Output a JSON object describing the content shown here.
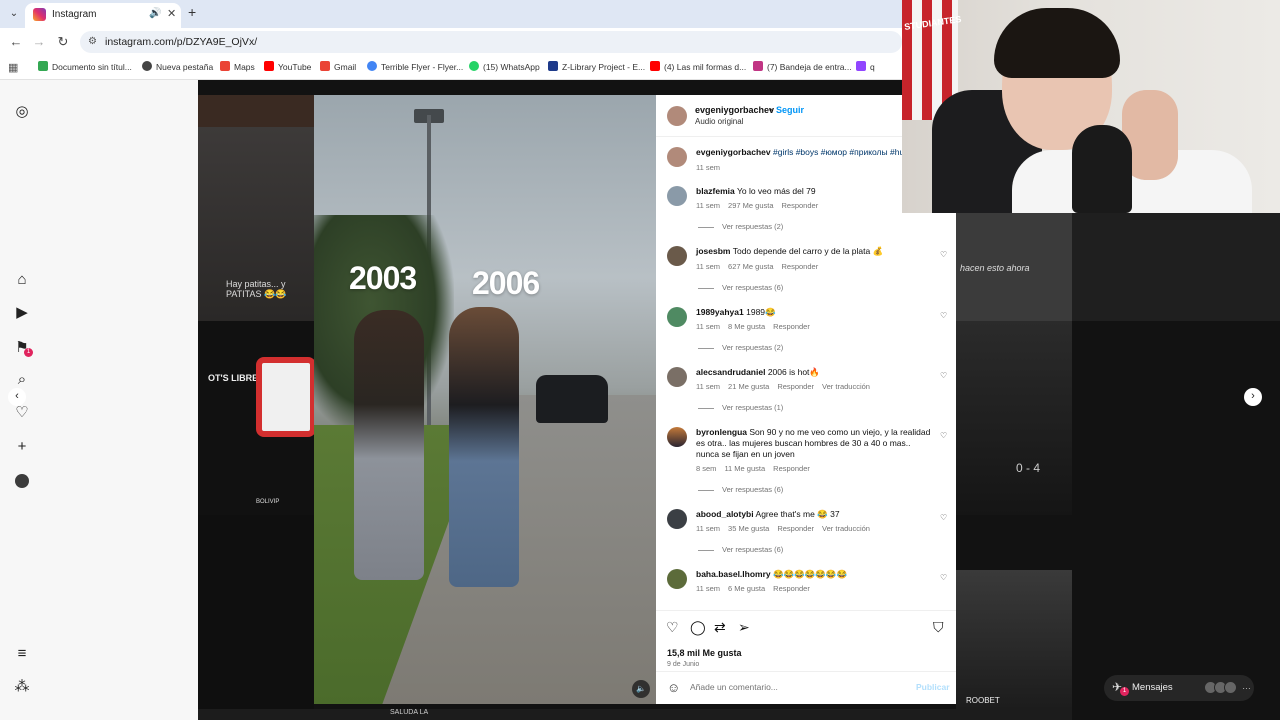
{
  "browser": {
    "tab": {
      "title": "Instagram"
    },
    "url": "instagram.com/p/DZYA9E_OjVx/",
    "bookmarks": [
      {
        "label": "Documento sin títul...",
        "color": "#34a853"
      },
      {
        "label": "Nueva pestaña",
        "color": "#444444"
      },
      {
        "label": "Maps",
        "color": "#ea4335"
      },
      {
        "label": "YouTube",
        "color": "#ff0000"
      },
      {
        "label": "Gmail",
        "color": "#ea4335"
      },
      {
        "label": "Terrible Flyer - Flyer...",
        "color": "#4285f4"
      },
      {
        "label": "(15) WhatsApp",
        "color": "#25d366"
      },
      {
        "label": "Z-Library Project - E...",
        "color": "#1e3a8a"
      },
      {
        "label": "(4) Las mil formas d...",
        "color": "#ff0000"
      },
      {
        "label": "(7) Bandeja de entra...",
        "color": "#c13584"
      },
      {
        "label": "q",
        "color": "#9146ff"
      }
    ]
  },
  "rail": {
    "icons": [
      "instagram-icon",
      "home-icon",
      "reels-icon",
      "activity-icon",
      "search-icon",
      "heart-icon",
      "create-icon",
      "profile-avatar",
      "menu-icon",
      "threads-icon"
    ],
    "badge": "1"
  },
  "post": {
    "overlay": {
      "year_left": "2003",
      "year_right": "2006"
    },
    "author": "evgeniygorbachev",
    "dot": "•",
    "follow": "Seguir",
    "audio": "Audio original",
    "caption": {
      "user": "evgeniygorbachev",
      "text": "#girls #boys #юмор #приколы #hu",
      "time": "11 sem"
    },
    "comments": [
      {
        "user": "blazfemia",
        "text": "Yo lo veo más del 79",
        "time": "11 sem",
        "likes": "297 Me gusta",
        "reply": "Responder",
        "translate": "",
        "replies": "Ver respuestas (2)",
        "heart": false
      },
      {
        "user": "josesbm",
        "text": "Todo depende del carro y de la plata 💰",
        "time": "11 sem",
        "likes": "627 Me gusta",
        "reply": "Responder",
        "translate": "",
        "replies": "Ver respuestas (6)",
        "heart": true
      },
      {
        "user": "1989yahya1",
        "text": "1989😂",
        "time": "11 sem",
        "likes": "8 Me gusta",
        "reply": "Responder",
        "translate": "",
        "replies": "Ver respuestas (2)",
        "heart": true
      },
      {
        "user": "alecsandrudaniel",
        "text": "2006 is hot🔥",
        "time": "11 sem",
        "likes": "21 Me gusta",
        "reply": "Responder",
        "translate": "Ver traducción",
        "replies": "Ver respuestas (1)",
        "heart": true
      },
      {
        "user": "byronlengua",
        "text": "Son 90 y no me veo como un viejo, y la realidad es otra.. las mujeres buscan hombres de 30 a 40 o mas.. nunca se fijan en un joven",
        "time": "8 sem",
        "likes": "11 Me gusta",
        "reply": "Responder",
        "translate": "",
        "replies": "Ver respuestas (6)",
        "heart": true
      },
      {
        "user": "abood_alotybi",
        "text": "Agree that's me 😂 37",
        "time": "11 sem",
        "likes": "35 Me gusta",
        "reply": "Responder",
        "translate": "Ver traducción",
        "replies": "Ver respuestas (6)",
        "heart": true
      },
      {
        "user": "baha.basel.lhomry",
        "text": "😂😂😂😂😂😂😂",
        "time": "11 sem",
        "likes": "6 Me gusta",
        "reply": "Responder",
        "translate": "",
        "replies": "",
        "heart": true
      }
    ],
    "likes_total": "15,8 mil Me gusta",
    "date": "9 de Junio",
    "add_comment_placeholder": "Añade un comentario...",
    "publish": "Publicar"
  },
  "grid": {
    "left_tile_text": "Hay patitas... y PATITAS 😂😂",
    "right_tile_text": "hacen esto ahora",
    "left_brand": "OT'S LIBRES",
    "left_bottom": "BOLIVIP",
    "right_bottom": "ROOBET",
    "score": "0 - 4",
    "bottom_strip": [
      "SALUDA LA"
    ]
  },
  "messages": {
    "label": "Mensajes",
    "badge": "1"
  },
  "webcam": {
    "flag_text": "STUDIANTES"
  }
}
